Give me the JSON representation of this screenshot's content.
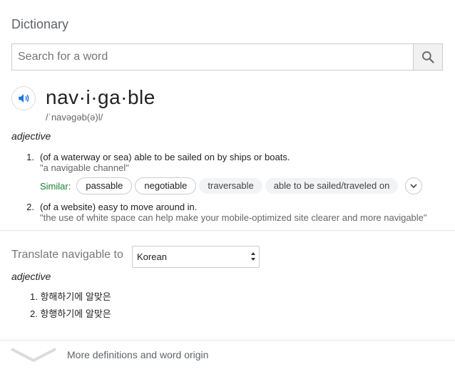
{
  "header": {
    "title": "Dictionary"
  },
  "search": {
    "placeholder": "Search for a word",
    "value": "",
    "button_icon": "search-icon"
  },
  "entry": {
    "word": "nav·i·ga·ble",
    "phonetic": "/ˈnavəɡəb(ə)l/",
    "pronounce_icon": "speaker-icon",
    "part_of_speech": "adjective",
    "senses": [
      {
        "number": "1.",
        "definition": "(of a waterway or sea) able to be sailed on by ships or boats.",
        "example": "\"a navigable channel\""
      },
      {
        "number": "2.",
        "definition": "(of a website) easy to move around in.",
        "example": "\"the use of white space can help make your mobile-optimized site clearer and more navigable\""
      }
    ],
    "similar": {
      "label": "Similar:",
      "chips": [
        "passable",
        "negotiable",
        "traversable",
        "able to be sailed/traveled on"
      ],
      "expand_icon": "chevron-down-icon"
    }
  },
  "translate": {
    "label": "Translate navigable to",
    "language": "Korean",
    "part_of_speech": "adjective",
    "items": [
      {
        "number": "1.",
        "text": "항해하기에 알맞은"
      },
      {
        "number": "2.",
        "text": "항행하기에 알맞은"
      }
    ]
  },
  "footer": {
    "more_label": "More definitions and word origin",
    "chevron_icon": "chevron-down-icon"
  }
}
